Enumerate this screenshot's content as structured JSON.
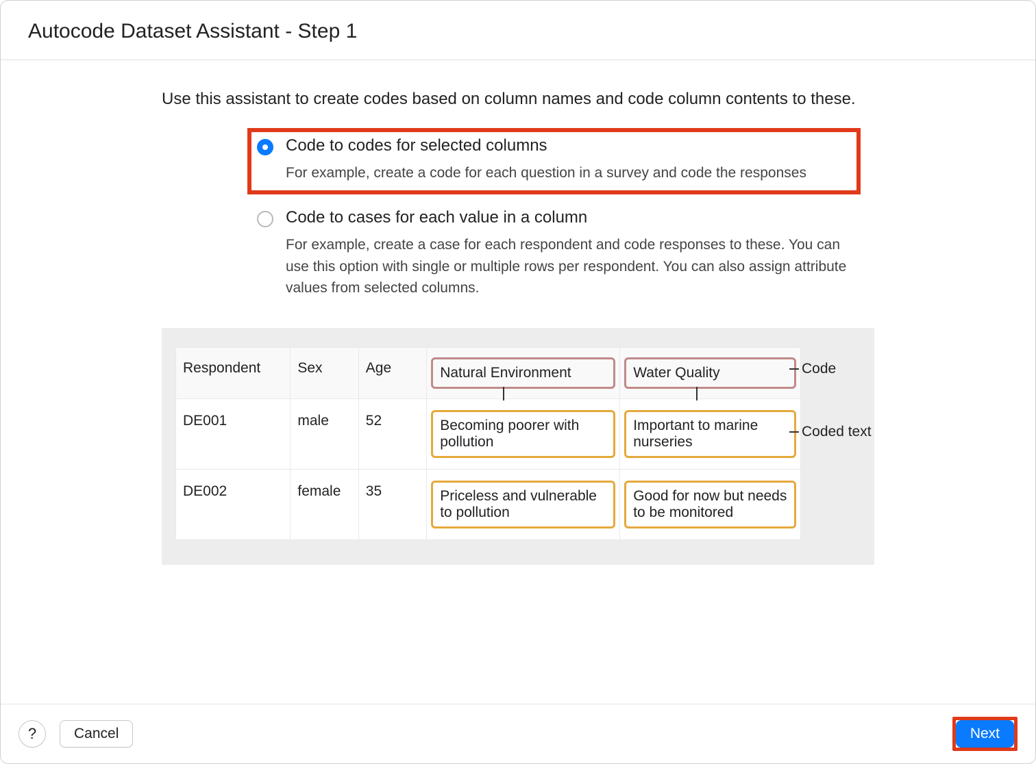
{
  "title": "Autocode Dataset Assistant - Step 1",
  "intro": "Use this assistant to create codes based on column names and code column contents to these.",
  "options": [
    {
      "label": "Code to codes for selected columns",
      "desc": "For example, create a code for each question in a survey and code the responses",
      "checked": true,
      "highlighted": true
    },
    {
      "label": "Code to cases for each value in a column",
      "desc": "For example, create a case for each respondent and code responses to these. You can use this option with single or multiple rows per respondent. You can also assign attribute values from selected columns.",
      "checked": false,
      "highlighted": false
    }
  ],
  "table": {
    "headers": [
      "Respondent",
      "Sex",
      "Age",
      "Natural Environment",
      "Water Quality"
    ],
    "rows": [
      [
        "DE001",
        "male",
        "52",
        "Becoming poorer with pollution",
        "Important to marine nurseries"
      ],
      [
        "DE002",
        "female",
        "35",
        "Priceless and vulnerable to pollution",
        "Good for now but needs to be monitored"
      ]
    ]
  },
  "annotations": {
    "code": "Code",
    "coded_text": "Coded text"
  },
  "footer": {
    "help": "?",
    "cancel": "Cancel",
    "next": "Next"
  }
}
